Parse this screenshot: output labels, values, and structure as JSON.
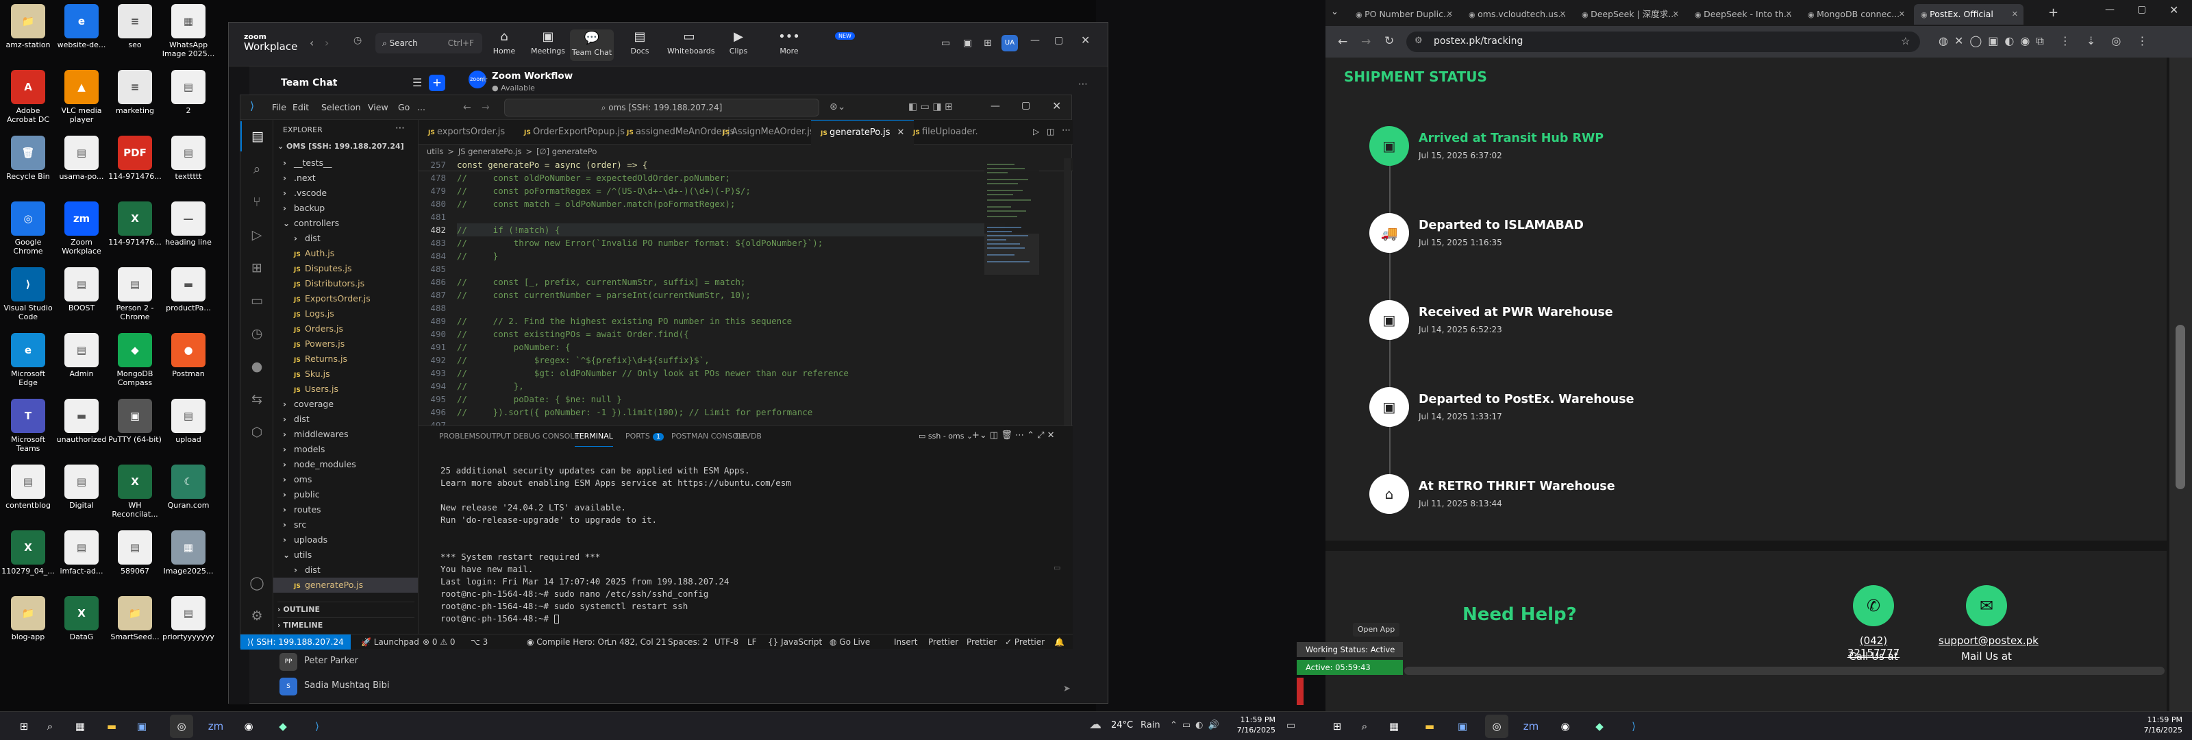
{
  "desktop": {
    "icons": [
      {
        "label": "amz-station",
        "col": 0,
        "row": 0,
        "color": "#d8c9a0",
        "glyph": "📁"
      },
      {
        "label": "website-de...",
        "col": 1,
        "row": 0,
        "color": "#1a73e8",
        "glyph": "e"
      },
      {
        "label": "seo",
        "col": 2,
        "row": 0,
        "color": "#e8e8e8",
        "glyph": "≡"
      },
      {
        "label": "WhatsApp Image 2025...",
        "col": 3,
        "row": 0,
        "color": "#f0f0f0",
        "glyph": "▦"
      },
      {
        "label": "Adobe Acrobat DC",
        "col": 0,
        "row": 1,
        "color": "#d62d20",
        "glyph": "A"
      },
      {
        "label": "VLC media player",
        "col": 1,
        "row": 1,
        "color": "#f08a00",
        "glyph": "▲"
      },
      {
        "label": "marketing",
        "col": 2,
        "row": 1,
        "color": "#e8e8e8",
        "glyph": "≡"
      },
      {
        "label": "2",
        "col": 3,
        "row": 1,
        "color": "#f0f0f0",
        "glyph": "▤"
      },
      {
        "label": "Recycle Bin",
        "col": 0,
        "row": 2,
        "color": "#6a8fb5",
        "glyph": "🗑"
      },
      {
        "label": "usama-po...",
        "col": 1,
        "row": 2,
        "color": "#f0f0f0",
        "glyph": "▤"
      },
      {
        "label": "114-971476...",
        "col": 2,
        "row": 2,
        "color": "#d62d20",
        "glyph": "PDF"
      },
      {
        "label": "texttttt",
        "col": 3,
        "row": 2,
        "color": "#f0f0f0",
        "glyph": "▤"
      },
      {
        "label": "Google Chrome",
        "col": 0,
        "row": 3,
        "color": "#1a73e8",
        "glyph": "◎"
      },
      {
        "label": "Zoom Workplace",
        "col": 1,
        "row": 3,
        "color": "#0b5cff",
        "glyph": "zm"
      },
      {
        "label": "114-971476...",
        "col": 2,
        "row": 3,
        "color": "#1d6f42",
        "glyph": "X"
      },
      {
        "label": "heading line",
        "col": 3,
        "row": 3,
        "color": "#f0f0f0",
        "glyph": "—"
      },
      {
        "label": "Visual Studio Code",
        "col": 0,
        "row": 4,
        "color": "#0065a9",
        "glyph": "⟩"
      },
      {
        "label": "BOOST",
        "col": 1,
        "row": 4,
        "color": "#f0f0f0",
        "glyph": "▤"
      },
      {
        "label": "Person 2 - Chrome",
        "col": 2,
        "row": 4,
        "color": "#f0f0f0",
        "glyph": "▤"
      },
      {
        "label": "productPa...",
        "col": 3,
        "row": 4,
        "color": "#f0f0f0",
        "glyph": "▬"
      },
      {
        "label": "Microsoft Edge",
        "col": 0,
        "row": 5,
        "color": "#0f8bd6",
        "glyph": "e"
      },
      {
        "label": "Admin",
        "col": 1,
        "row": 5,
        "color": "#f0f0f0",
        "glyph": "▤"
      },
      {
        "label": "MongoDB Compass",
        "col": 2,
        "row": 5,
        "color": "#13aa52",
        "glyph": "◆"
      },
      {
        "label": "Postman",
        "col": 3,
        "row": 5,
        "color": "#ef5b25",
        "glyph": "●"
      },
      {
        "label": "Microsoft Teams",
        "col": 0,
        "row": 6,
        "color": "#4b53bc",
        "glyph": "T"
      },
      {
        "label": "unauthorized",
        "col": 1,
        "row": 6,
        "color": "#f0f0f0",
        "glyph": "▬"
      },
      {
        "label": "PuTTY (64-bit)",
        "col": 2,
        "row": 6,
        "color": "#555",
        "glyph": "▣"
      },
      {
        "label": "upload",
        "col": 3,
        "row": 6,
        "color": "#f0f0f0",
        "glyph": "▤"
      },
      {
        "label": "contentblog",
        "col": 0,
        "row": 7,
        "color": "#f0f0f0",
        "glyph": "▤"
      },
      {
        "label": "Digital",
        "col": 1,
        "row": 7,
        "color": "#f0f0f0",
        "glyph": "▤"
      },
      {
        "label": "WH Reconcilat...",
        "col": 2,
        "row": 7,
        "color": "#1d6f42",
        "glyph": "X"
      },
      {
        "label": "Quran.com",
        "col": 3,
        "row": 7,
        "color": "#2a7f62",
        "glyph": "☾"
      },
      {
        "label": "110279_04_...",
        "col": 0,
        "row": 8,
        "color": "#1d6f42",
        "glyph": "X"
      },
      {
        "label": "imfact-ad...",
        "col": 1,
        "row": 8,
        "color": "#f0f0f0",
        "glyph": "▤"
      },
      {
        "label": "589067",
        "col": 2,
        "row": 8,
        "color": "#f0f0f0",
        "glyph": "▤"
      },
      {
        "label": "Image2025...",
        "col": 3,
        "row": 8,
        "color": "#8a9aa8",
        "glyph": "▦"
      },
      {
        "label": "blog-app",
        "col": 0,
        "row": 9,
        "color": "#d8c9a0",
        "glyph": "📁"
      },
      {
        "label": "DataG",
        "col": 1,
        "row": 9,
        "color": "#1d6f42",
        "glyph": "X"
      },
      {
        "label": "SmartSeed...",
        "col": 2,
        "row": 9,
        "color": "#d8c9a0",
        "glyph": "📁"
      },
      {
        "label": "priortyyyyyyy",
        "col": 3,
        "row": 9,
        "color": "#f0f0f0",
        "glyph": "▤"
      }
    ]
  },
  "zoom": {
    "logo_line1": "zoom",
    "logo_line2": "Workplace",
    "search_label": "Search",
    "search_shortcut": "Ctrl+F",
    "nav": [
      {
        "label": "Home",
        "glyph": "⌂"
      },
      {
        "label": "Meetings",
        "glyph": "▣"
      },
      {
        "label": "Team Chat",
        "glyph": "💬"
      },
      {
        "label": "Docs",
        "glyph": "▤"
      },
      {
        "label": "Whiteboards",
        "glyph": "▭"
      },
      {
        "label": "Clips",
        "glyph": "▶"
      },
      {
        "label": "More",
        "glyph": "•••"
      }
    ],
    "new_badge": "NEW",
    "user_initials": "UA",
    "section_title": "Team Chat",
    "channel_name": "Zoom Workflow",
    "channel_status": "Available",
    "contacts": [
      {
        "name": "Peter Parker",
        "initials": "PP"
      },
      {
        "name": "Sadia Mushtaq Bibi",
        "initials": "S"
      }
    ]
  },
  "vscode": {
    "menu": [
      "File",
      "Edit",
      "Selection",
      "View",
      "Go",
      "..."
    ],
    "command_center": "oms [SSH: 199.188.207.24]",
    "explorer_title": "EXPLORER",
    "workspace": "OMS [SSH: 199.188.207.24]",
    "tree": [
      {
        "name": "__tests__",
        "indent": 1,
        "type": "folder"
      },
      {
        "name": ".next",
        "indent": 1,
        "type": "folder"
      },
      {
        "name": ".vscode",
        "indent": 1,
        "type": "folder"
      },
      {
        "name": "backup",
        "indent": 1,
        "type": "folder"
      },
      {
        "name": "controllers",
        "indent": 1,
        "type": "open"
      },
      {
        "name": "dist",
        "indent": 2,
        "type": "folder"
      },
      {
        "name": "Auth.js",
        "indent": 2,
        "type": "js"
      },
      {
        "name": "Disputes.js",
        "indent": 2,
        "type": "js"
      },
      {
        "name": "Distributors.js",
        "indent": 2,
        "type": "js"
      },
      {
        "name": "ExportsOrder.js",
        "indent": 2,
        "type": "js"
      },
      {
        "name": "Logs.js",
        "indent": 2,
        "type": "js"
      },
      {
        "name": "Orders.js",
        "indent": 2,
        "type": "js"
      },
      {
        "name": "Powers.js",
        "indent": 2,
        "type": "js"
      },
      {
        "name": "Returns.js",
        "indent": 2,
        "type": "js"
      },
      {
        "name": "Sku.js",
        "indent": 2,
        "type": "js"
      },
      {
        "name": "Users.js",
        "indent": 2,
        "type": "js"
      },
      {
        "name": "coverage",
        "indent": 1,
        "type": "folder"
      },
      {
        "name": "dist",
        "indent": 1,
        "type": "folder"
      },
      {
        "name": "middlewares",
        "indent": 1,
        "type": "folder"
      },
      {
        "name": "models",
        "indent": 1,
        "type": "folder"
      },
      {
        "name": "node_modules",
        "indent": 1,
        "type": "folder"
      },
      {
        "name": "oms",
        "indent": 1,
        "type": "folder"
      },
      {
        "name": "public",
        "indent": 1,
        "type": "folder"
      },
      {
        "name": "routes",
        "indent": 1,
        "type": "folder"
      },
      {
        "name": "src",
        "indent": 1,
        "type": "folder"
      },
      {
        "name": "uploads",
        "indent": 1,
        "type": "folder"
      },
      {
        "name": "utils",
        "indent": 1,
        "type": "open"
      },
      {
        "name": "dist",
        "indent": 2,
        "type": "folder"
      },
      {
        "name": "generatePo.js",
        "indent": 2,
        "type": "js-active"
      }
    ],
    "outline_label": "OUTLINE",
    "timeline_label": "TIMELINE",
    "tabs": [
      {
        "label": "exportsOrder.js",
        "active": false
      },
      {
        "label": "OrderExportPopup.js",
        "active": false
      },
      {
        "label": "assignedMeAnOrder.js",
        "active": false
      },
      {
        "label": "AssignMeAOrder.js",
        "active": false
      },
      {
        "label": "generatePo.js",
        "active": true
      },
      {
        "label": "fileUploader.",
        "active": false
      }
    ],
    "breadcrumb": [
      "utils",
      ">",
      "JS generatePo.js",
      ">",
      "[∅] generatePo"
    ],
    "sticky_line": {
      "num": "257",
      "text": "const generatePo = async (order) => {"
    },
    "code_lines": [
      {
        "num": "478",
        "text": "//     const oldPoNumber = expectedOldOrder.poNumber;"
      },
      {
        "num": "479",
        "text": "//     const poFormatRegex = /^(US-Q\\d+-\\d+-)(\\d+)(-P)$/;"
      },
      {
        "num": "480",
        "text": "//     const match = oldPoNumber.match(poFormatRegex);"
      },
      {
        "num": "481",
        "text": ""
      },
      {
        "num": "482",
        "text": "//     if (!match) {"
      },
      {
        "num": "483",
        "text": "//         throw new Error(`Invalid PO number format: ${oldPoNumber}`);"
      },
      {
        "num": "484",
        "text": "//     }"
      },
      {
        "num": "485",
        "text": ""
      },
      {
        "num": "486",
        "text": "//     const [_, prefix, currentNumStr, suffix] = match;"
      },
      {
        "num": "487",
        "text": "//     const currentNumber = parseInt(currentNumStr, 10);"
      },
      {
        "num": "488",
        "text": ""
      },
      {
        "num": "489",
        "text": "//     // 2. Find the highest existing PO number in this sequence"
      },
      {
        "num": "490",
        "text": "//     const existingPOs = await Order.find({"
      },
      {
        "num": "491",
        "text": "//         poNumber: {"
      },
      {
        "num": "492",
        "text": "//             $regex: `^${prefix}\\d+${suffix}$`,"
      },
      {
        "num": "493",
        "text": "//             $gt: oldPoNumber // Only look at POs newer than our reference"
      },
      {
        "num": "494",
        "text": "//         },"
      },
      {
        "num": "495",
        "text": "//         poDate: { $ne: null }"
      },
      {
        "num": "496",
        "text": "//     }).sort({ poNumber: -1 }).limit(100); // Limit for performance"
      },
      {
        "num": "497",
        "text": ""
      }
    ],
    "panel_tabs": [
      "PROBLEMS",
      "OUTPUT",
      "DEBUG CONSOLE",
      "TERMINAL",
      "PORTS",
      "POSTMAN CONSOLE",
      "DEVDB"
    ],
    "ports_count": "1",
    "terminal_name": "ssh - oms",
    "terminal_lines": [
      "",
      "25 additional security updates can be applied with ESM Apps.",
      "Learn more about enabling ESM Apps service at https://ubuntu.com/esm",
      "",
      "New release '24.04.2 LTS' available.",
      "Run 'do-release-upgrade' to upgrade to it.",
      "",
      "",
      "*** System restart required ***",
      "You have new mail.",
      "Last login: Fri Mar 14 17:07:40 2025 from 199.188.207.24",
      "root@nc-ph-1564-48:~# sudo nano /etc/ssh/sshd_config",
      "root@nc-ph-1564-48:~# sudo systemctl restart ssh",
      "root@nc-ph-1564-48:~# "
    ],
    "status": {
      "remote": "SSH: 199.188.207.24",
      "launchpad": "Launchpad",
      "problems": "⊗ 0 ⚠ 0",
      "ports": "⌥ 3",
      "compile": "Compile Hero: On",
      "position": "Ln 482, Col 21",
      "spaces": "Spaces: 2",
      "encoding": "UTF-8",
      "eol": "LF",
      "language": "{} JavaScript",
      "golive": "Go Live",
      "insert": "Insert",
      "prettier1": "Prettier",
      "prettier2": "Prettier",
      "prettier3": "✓ Prettier"
    }
  },
  "chrome": {
    "tabs": [
      {
        "label": "PO Number Duplic...",
        "active": false
      },
      {
        "label": "oms.vcloudtech.us...",
        "active": false
      },
      {
        "label": "DeepSeek | 深度求...",
        "active": false
      },
      {
        "label": "DeepSeek - Into th...",
        "active": false
      },
      {
        "label": "MongoDB connec...",
        "active": false
      },
      {
        "label": "PostEx. Official",
        "active": true
      }
    ],
    "url": "postex.pk/tracking",
    "page": {
      "heading": "SHIPMENT STATUS",
      "steps": [
        {
          "title": "Arrived at Transit Hub RWP",
          "date": "Jul 15, 2025 6:37:02",
          "active": true,
          "glyph": "▣"
        },
        {
          "title": "Departed to ISLAMABAD",
          "date": "Jul 15, 2025 1:16:35",
          "active": false,
          "glyph": "🚚"
        },
        {
          "title": "Received at PWR Warehouse",
          "date": "Jul 14, 2025 6:52:23",
          "active": false,
          "glyph": "▣"
        },
        {
          "title": "Departed to PostEx. Warehouse",
          "date": "Jul 14, 2025 1:33:17",
          "active": false,
          "glyph": "▣"
        },
        {
          "title": "At RETRO THRIFT Warehouse",
          "date": "Jul 11, 2025 8:13:44",
          "active": false,
          "glyph": "⌂"
        }
      ],
      "help_title": "Need Help?",
      "phone": "(042) 32157777",
      "phone_caption": "Call Us at",
      "email": "support@postex.pk",
      "email_caption": "Mail Us at"
    }
  },
  "zoom_popup": {
    "open_app": "Open App",
    "status": "Working Status: Active",
    "active_line": "Active: 05:59:43"
  },
  "taskbar": {
    "weather_temp": "24°C",
    "weather_text": "Rain",
    "time": "11:59 PM",
    "date": "7/16/2025",
    "time2": "11:59 PM",
    "date2": "7/16/2025"
  }
}
